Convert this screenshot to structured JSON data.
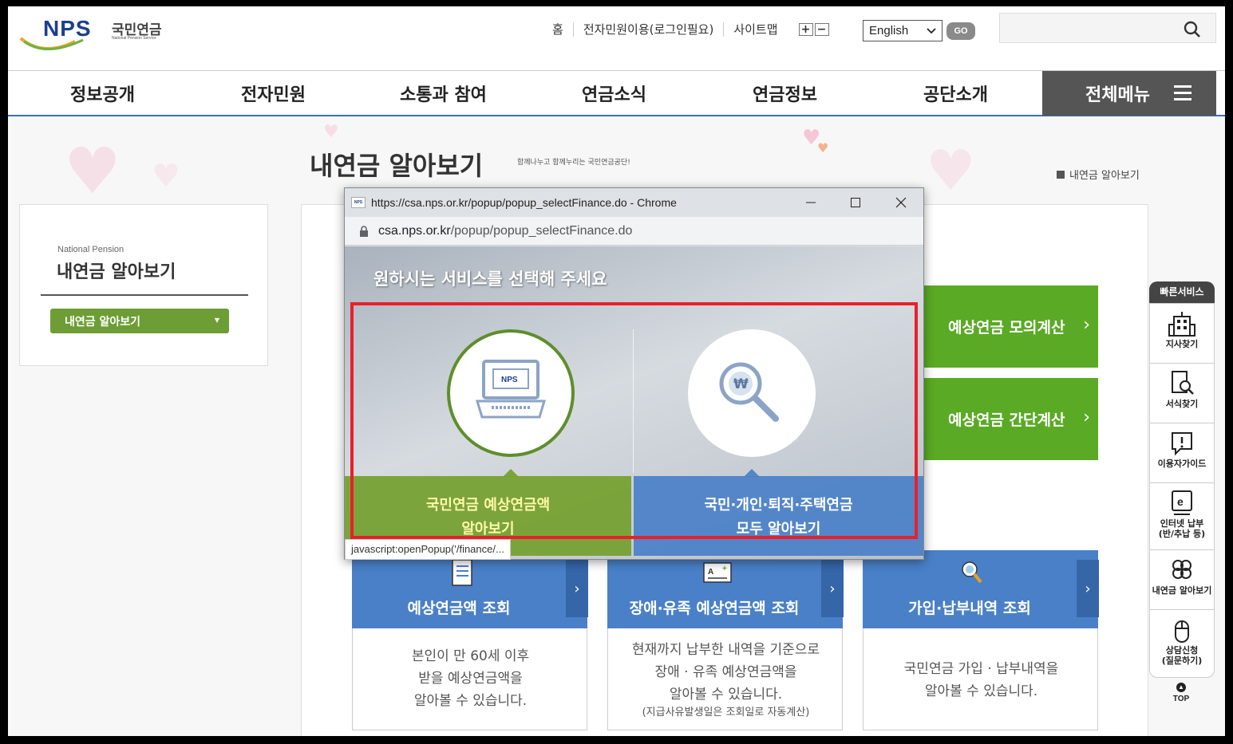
{
  "logo": {
    "text": "NPS",
    "ko": "국민연금",
    "en": "National Pension Service"
  },
  "util_links": [
    "홈",
    "전자민원이용(로그인필요)",
    "사이트맵"
  ],
  "font_controls": {
    "plus": "+",
    "minus": "−"
  },
  "language": {
    "selected": "English",
    "go_label": "GO"
  },
  "search": {
    "placeholder": ""
  },
  "gnb": {
    "items": [
      "정보공개",
      "전자민원",
      "소통과 참여",
      "연금소식",
      "연금정보",
      "공단소개"
    ],
    "all_menu": "전체메뉴"
  },
  "page": {
    "title": "내연금 알아보기",
    "subtitle": "함께나누고 함께누리는 국민연금공단!",
    "breadcrumb": "내연금 알아보기"
  },
  "lnb": {
    "en": "National Pension",
    "title": "내연금 알아보기",
    "select": "내연금 알아보기"
  },
  "green_cards": [
    "예상연금 모의계산",
    "예상연금 간단계산"
  ],
  "blue_cards": [
    {
      "title": "예상연금액 조회",
      "desc": [
        "본인이 만 60세 이후",
        "받을 예상연금액을",
        "알아볼 수 있습니다."
      ],
      "note": ""
    },
    {
      "title": "장애·유족 예상연금액 조회",
      "desc": [
        "현재까지 납부한 내역을 기준으로",
        "장애 · 유족 예상연금액을",
        "알아볼 수 있습니다."
      ],
      "note": "(지급사유발생일은 조회일로 자동계산)"
    },
    {
      "title": "가입·납부내역 조회",
      "desc": [
        "국민연금 가입 · 납부내역을",
        "알아볼 수 있습니다."
      ],
      "note": ""
    }
  ],
  "quick_menu": {
    "header": "빠른서비스",
    "items": [
      "지사찾기",
      "서식찾기",
      "이용자가이드",
      "인터넷 납부\n(반/추납 등)",
      "내연금 알아보기",
      "상담신청\n(질문하기)"
    ],
    "top": "TOP"
  },
  "popup": {
    "window_title": "https://csa.nps.or.kr/popup/popup_selectFinance.do - Chrome",
    "url_domain": "csa.nps.or.kr",
    "url_path": "/popup/popup_selectFinance.do",
    "heading": "원하시는 서비스를 선택해 주세요",
    "option_left": [
      "국민연금 예상연금액",
      "알아보기"
    ],
    "option_right": [
      "국민·개인·퇴직·주택연금",
      "모두 알아보기"
    ],
    "status_tip": "javascript:openPopup('/finance/..."
  },
  "colors": {
    "highlight": "#e8202a",
    "green": "#5aaa25",
    "blue": "#4a80c8",
    "gnb_border": "#3b6fb5"
  }
}
